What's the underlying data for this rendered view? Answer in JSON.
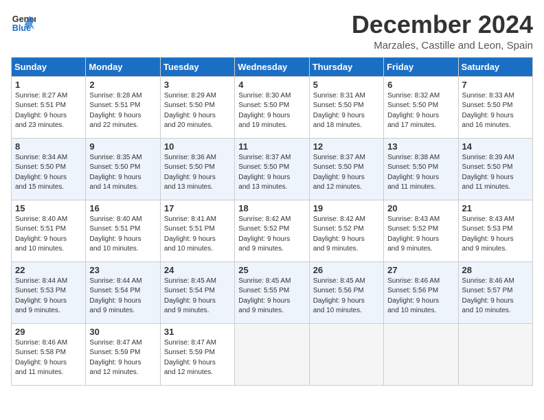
{
  "logo": {
    "line1": "General",
    "line2": "Blue"
  },
  "title": "December 2024",
  "subtitle": "Marzales, Castille and Leon, Spain",
  "days_header": [
    "Sunday",
    "Monday",
    "Tuesday",
    "Wednesday",
    "Thursday",
    "Friday",
    "Saturday"
  ],
  "weeks": [
    [
      {
        "day": "1",
        "info": "Sunrise: 8:27 AM\nSunset: 5:51 PM\nDaylight: 9 hours\nand 23 minutes."
      },
      {
        "day": "2",
        "info": "Sunrise: 8:28 AM\nSunset: 5:51 PM\nDaylight: 9 hours\nand 22 minutes."
      },
      {
        "day": "3",
        "info": "Sunrise: 8:29 AM\nSunset: 5:50 PM\nDaylight: 9 hours\nand 20 minutes."
      },
      {
        "day": "4",
        "info": "Sunrise: 8:30 AM\nSunset: 5:50 PM\nDaylight: 9 hours\nand 19 minutes."
      },
      {
        "day": "5",
        "info": "Sunrise: 8:31 AM\nSunset: 5:50 PM\nDaylight: 9 hours\nand 18 minutes."
      },
      {
        "day": "6",
        "info": "Sunrise: 8:32 AM\nSunset: 5:50 PM\nDaylight: 9 hours\nand 17 minutes."
      },
      {
        "day": "7",
        "info": "Sunrise: 8:33 AM\nSunset: 5:50 PM\nDaylight: 9 hours\nand 16 minutes."
      }
    ],
    [
      {
        "day": "8",
        "info": "Sunrise: 8:34 AM\nSunset: 5:50 PM\nDaylight: 9 hours\nand 15 minutes."
      },
      {
        "day": "9",
        "info": "Sunrise: 8:35 AM\nSunset: 5:50 PM\nDaylight: 9 hours\nand 14 minutes."
      },
      {
        "day": "10",
        "info": "Sunrise: 8:36 AM\nSunset: 5:50 PM\nDaylight: 9 hours\nand 13 minutes."
      },
      {
        "day": "11",
        "info": "Sunrise: 8:37 AM\nSunset: 5:50 PM\nDaylight: 9 hours\nand 13 minutes."
      },
      {
        "day": "12",
        "info": "Sunrise: 8:37 AM\nSunset: 5:50 PM\nDaylight: 9 hours\nand 12 minutes."
      },
      {
        "day": "13",
        "info": "Sunrise: 8:38 AM\nSunset: 5:50 PM\nDaylight: 9 hours\nand 11 minutes."
      },
      {
        "day": "14",
        "info": "Sunrise: 8:39 AM\nSunset: 5:50 PM\nDaylight: 9 hours\nand 11 minutes."
      }
    ],
    [
      {
        "day": "15",
        "info": "Sunrise: 8:40 AM\nSunset: 5:51 PM\nDaylight: 9 hours\nand 10 minutes."
      },
      {
        "day": "16",
        "info": "Sunrise: 8:40 AM\nSunset: 5:51 PM\nDaylight: 9 hours\nand 10 minutes."
      },
      {
        "day": "17",
        "info": "Sunrise: 8:41 AM\nSunset: 5:51 PM\nDaylight: 9 hours\nand 10 minutes."
      },
      {
        "day": "18",
        "info": "Sunrise: 8:42 AM\nSunset: 5:52 PM\nDaylight: 9 hours\nand 9 minutes."
      },
      {
        "day": "19",
        "info": "Sunrise: 8:42 AM\nSunset: 5:52 PM\nDaylight: 9 hours\nand 9 minutes."
      },
      {
        "day": "20",
        "info": "Sunrise: 8:43 AM\nSunset: 5:52 PM\nDaylight: 9 hours\nand 9 minutes."
      },
      {
        "day": "21",
        "info": "Sunrise: 8:43 AM\nSunset: 5:53 PM\nDaylight: 9 hours\nand 9 minutes."
      }
    ],
    [
      {
        "day": "22",
        "info": "Sunrise: 8:44 AM\nSunset: 5:53 PM\nDaylight: 9 hours\nand 9 minutes."
      },
      {
        "day": "23",
        "info": "Sunrise: 8:44 AM\nSunset: 5:54 PM\nDaylight: 9 hours\nand 9 minutes."
      },
      {
        "day": "24",
        "info": "Sunrise: 8:45 AM\nSunset: 5:54 PM\nDaylight: 9 hours\nand 9 minutes."
      },
      {
        "day": "25",
        "info": "Sunrise: 8:45 AM\nSunset: 5:55 PM\nDaylight: 9 hours\nand 9 minutes."
      },
      {
        "day": "26",
        "info": "Sunrise: 8:45 AM\nSunset: 5:56 PM\nDaylight: 9 hours\nand 10 minutes."
      },
      {
        "day": "27",
        "info": "Sunrise: 8:46 AM\nSunset: 5:56 PM\nDaylight: 9 hours\nand 10 minutes."
      },
      {
        "day": "28",
        "info": "Sunrise: 8:46 AM\nSunset: 5:57 PM\nDaylight: 9 hours\nand 10 minutes."
      }
    ],
    [
      {
        "day": "29",
        "info": "Sunrise: 8:46 AM\nSunset: 5:58 PM\nDaylight: 9 hours\nand 11 minutes."
      },
      {
        "day": "30",
        "info": "Sunrise: 8:47 AM\nSunset: 5:59 PM\nDaylight: 9 hours\nand 12 minutes."
      },
      {
        "day": "31",
        "info": "Sunrise: 8:47 AM\nSunset: 5:59 PM\nDaylight: 9 hours\nand 12 minutes."
      },
      null,
      null,
      null,
      null
    ]
  ]
}
